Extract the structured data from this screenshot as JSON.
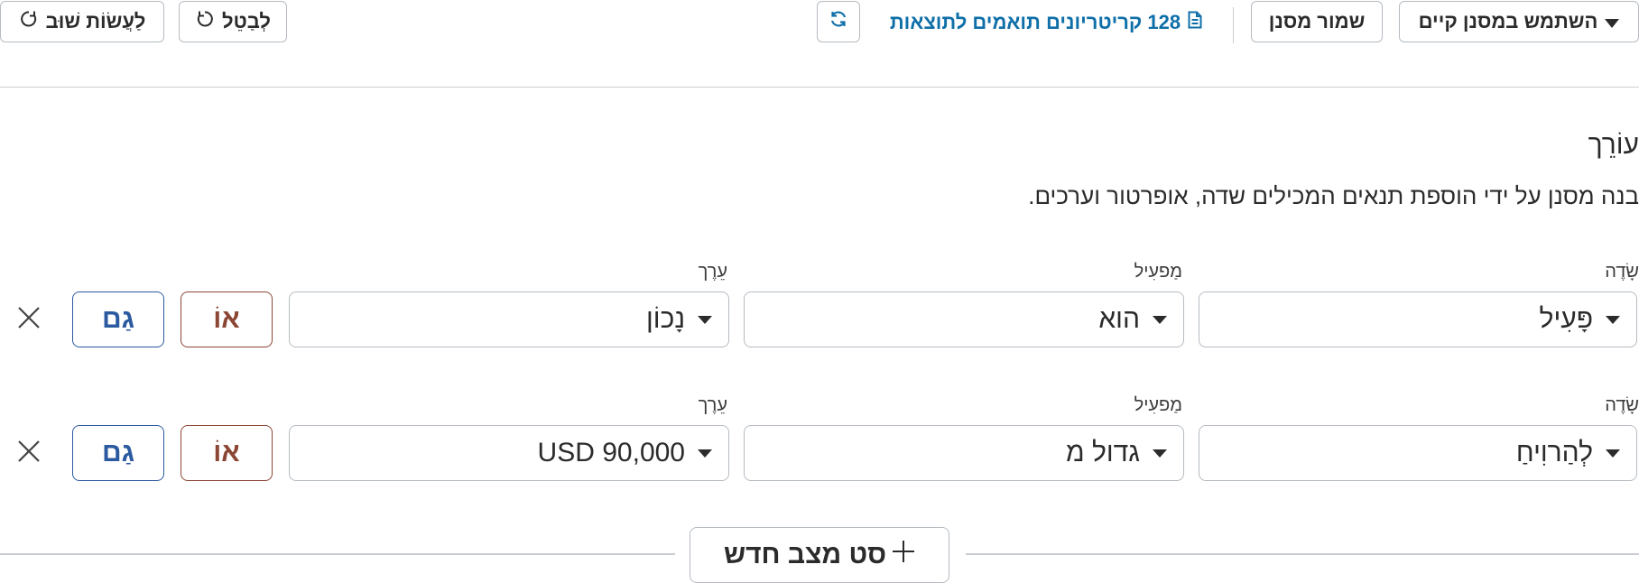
{
  "toolbar": {
    "use_existing_filter_label": "השתמש במסנן קיים",
    "save_filter_label": "שמור מסנן",
    "results_link_label": "128 קריטריונים תואמים לתוצאות",
    "cancel_label": "לְבַטֵל",
    "redo_label": "לַעֲשׂוֹת שׁוּב"
  },
  "editor": {
    "title": "עוֹרֵך",
    "description": "בנה מסנן על ידי הוספת תנאים המכילים שדה, אופרטור וערכים."
  },
  "conditions": [
    {
      "field_label": "שָׂדֶה",
      "field_value": "פָּעִיל",
      "operator_label": "מַפעִיל",
      "operator_value": "הוא",
      "value_label": "עֵרֶך",
      "value_value": "נָכוֹן",
      "or_label": "אוֹ",
      "and_label": "גַם"
    },
    {
      "field_label": "שָׂדֶה",
      "field_value": "לְהַרוִיחַ",
      "operator_label": "מַפעִיל",
      "operator_value": "גדול מ",
      "value_label": "עֵרֶך",
      "value_value": "90,000 USD",
      "or_label": "אוֹ",
      "and_label": "גַם"
    }
  ],
  "add_condition_set_label": "סט מצב חדש",
  "colors": {
    "link": "#0f6fa8",
    "or_button": "#8b4634",
    "and_button": "#2c5aa0",
    "border": "#b6bcc2"
  }
}
